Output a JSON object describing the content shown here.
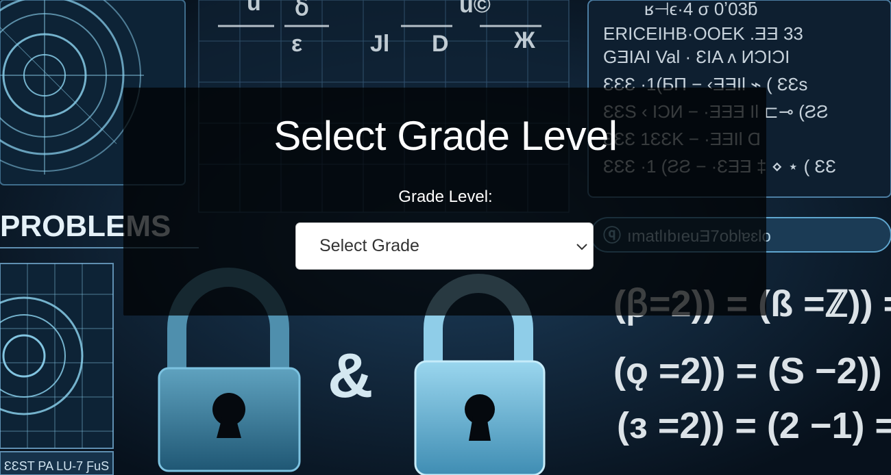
{
  "page": {
    "title": "Select Grade Level"
  },
  "form": {
    "grade_label": "Grade Level:",
    "grade_select": {
      "selected": "Select Grade"
    }
  },
  "background": {
    "banner_text": "PROBLEMS",
    "ampersand": "&",
    "icons": [
      "radar-dial-icon",
      "padlock-icon",
      "padlock-icon",
      "search-bar-icon"
    ]
  },
  "colors": {
    "overlay": "#000000",
    "title_text": "#ffffff",
    "select_bg": "#ffffff",
    "bg_accent": "#7fd3f5"
  }
}
